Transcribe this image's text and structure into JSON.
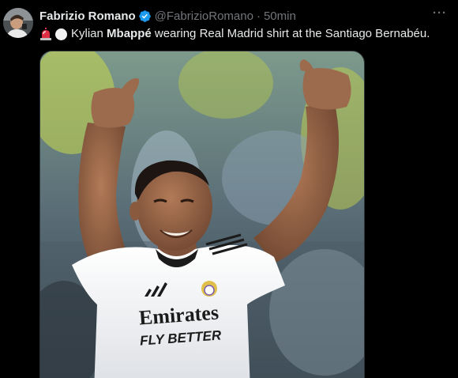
{
  "author": {
    "display_name": "Fabrizio Romano",
    "handle": "@FabrizioRomano",
    "separator": "·",
    "time": "50min",
    "verified_icon": "verified-badge-icon",
    "more_icon": "more-options-icon",
    "more_label": "···"
  },
  "tweet": {
    "emoji_1": "rotating-light-icon",
    "emoji_2": "white-circle-icon",
    "text_name_first": "Kylian ",
    "text_name_bold": "Mbappé",
    "text_rest": " wearing Real Madrid shirt at the Santiago Bernabéu."
  },
  "media": {
    "shirt_sponsor_line1": "Emirates",
    "shirt_sponsor_line2": "FLY BETTER"
  },
  "colors": {
    "background": "#000000",
    "text_primary": "#e7e9ea",
    "text_secondary": "#71767b",
    "verified_blue": "#1d9bf0"
  }
}
